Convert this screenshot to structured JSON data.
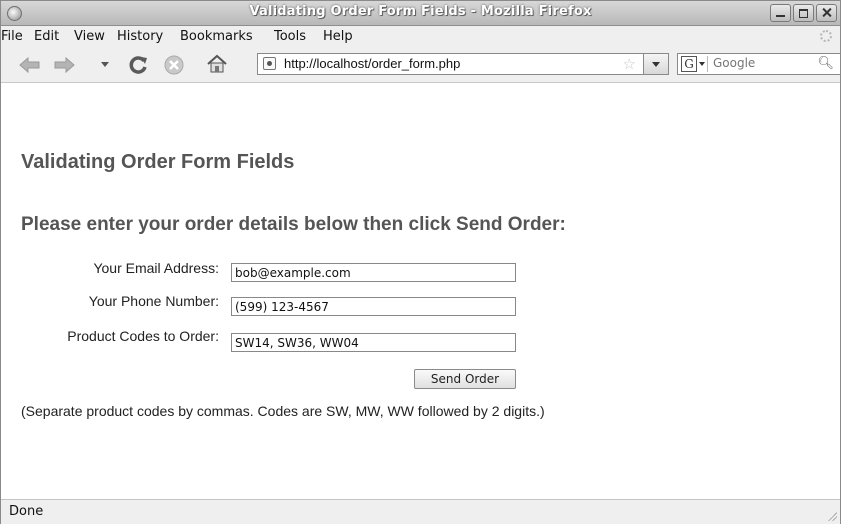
{
  "window": {
    "title": "Validating Order Form Fields - Mozilla Firefox"
  },
  "menu": [
    "File",
    "Edit",
    "View",
    "History",
    "Bookmarks",
    "Tools",
    "Help"
  ],
  "toolbar": {
    "url": "http://localhost/order_form.php",
    "search_placeholder": "Google",
    "search_engine_letter": "G"
  },
  "page": {
    "title": "Validating Order Form Fields",
    "instructions": "Please enter your order details below then click Send Order:",
    "form": {
      "email_label": "Your Email Address:",
      "email_value": "bob@example.com",
      "phone_label": "Your Phone Number:",
      "phone_value": "(599) 123-4567",
      "codes_label": "Product Codes to Order:",
      "codes_value": "SW14, SW36, WW04",
      "submit_label": "Send Order"
    },
    "note": "(Separate product codes by commas. Codes are SW, MW, WW followed by 2 digits.)"
  },
  "status": {
    "text": "Done"
  },
  "icons": {
    "back": "back-arrow-icon",
    "forward": "forward-arrow-icon",
    "reload": "reload-icon",
    "stop": "stop-icon",
    "home": "home-icon",
    "bookmark": "star-icon",
    "search": "magnifier-icon"
  }
}
